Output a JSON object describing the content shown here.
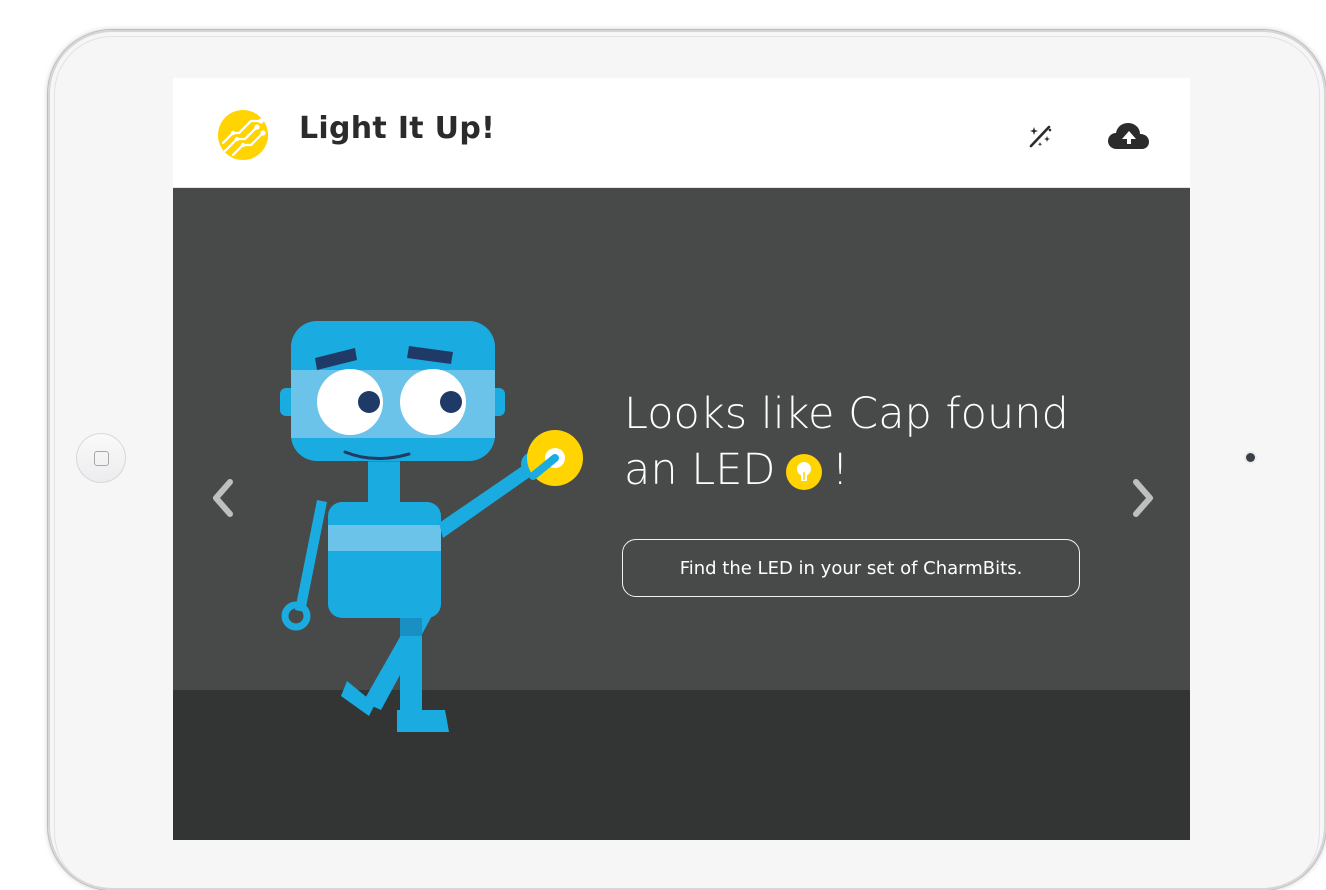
{
  "app": {
    "title": "Light It Up!",
    "logo_icon": "circuit-logo-icon",
    "actions": [
      {
        "name": "magic-wand-icon"
      },
      {
        "name": "cloud-upload-icon"
      }
    ]
  },
  "slide": {
    "headline_part1": "Looks like Cap found",
    "headline_part2": "an LED",
    "headline_part3": "!",
    "instruction": "Find the LED in your set of CharmBits.",
    "character": "robot-cap-illustration",
    "badge_icon": "lightbulb-icon"
  },
  "navigation": {
    "prev_icon": "chevron-left-icon",
    "next_icon": "chevron-right-icon"
  },
  "colors": {
    "accent_yellow": "#FFD400",
    "robot_blue": "#1AACE0",
    "robot_light_blue": "#6BC3EA",
    "stage_bg": "#484949",
    "floor_bg": "#333434",
    "header_bg": "#FFFFFF"
  }
}
